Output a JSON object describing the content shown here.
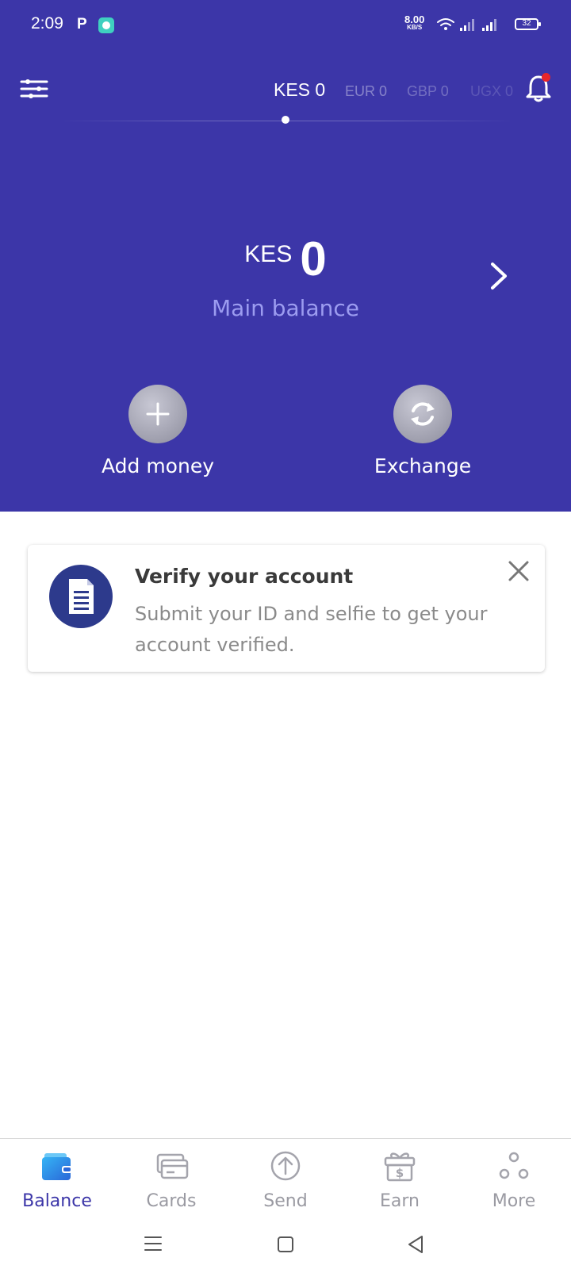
{
  "status_bar": {
    "time": "2:09",
    "app_p": "P",
    "net_speed": "8.00",
    "net_unit": "KB/S",
    "battery": "32"
  },
  "currency_tabs": [
    {
      "label": "KES 0",
      "active": true
    },
    {
      "label": "EUR 0",
      "active": false
    },
    {
      "label": "GBP 0",
      "active": false
    },
    {
      "label": "UGX 0",
      "active": false
    }
  ],
  "balance": {
    "currency": "KES",
    "amount": "0",
    "label": "Main balance"
  },
  "actions": {
    "add_money": "Add money",
    "exchange": "Exchange"
  },
  "verify_card": {
    "title": "Verify your account",
    "text": "Submit your ID and selfie to get your account verified."
  },
  "bottom_nav": [
    {
      "label": "Balance",
      "icon": "wallet-icon",
      "active": true
    },
    {
      "label": "Cards",
      "icon": "cards-icon",
      "active": false
    },
    {
      "label": "Send",
      "icon": "send-icon",
      "active": false
    },
    {
      "label": "Earn",
      "icon": "gift-icon",
      "active": false
    },
    {
      "label": "More",
      "icon": "more-icon",
      "active": false
    }
  ],
  "colors": {
    "primary": "#3c36a8",
    "nav_active": "#3c36a8",
    "notification_dot": "#e8262a",
    "doc_icon_bg": "#2d3a8c"
  }
}
